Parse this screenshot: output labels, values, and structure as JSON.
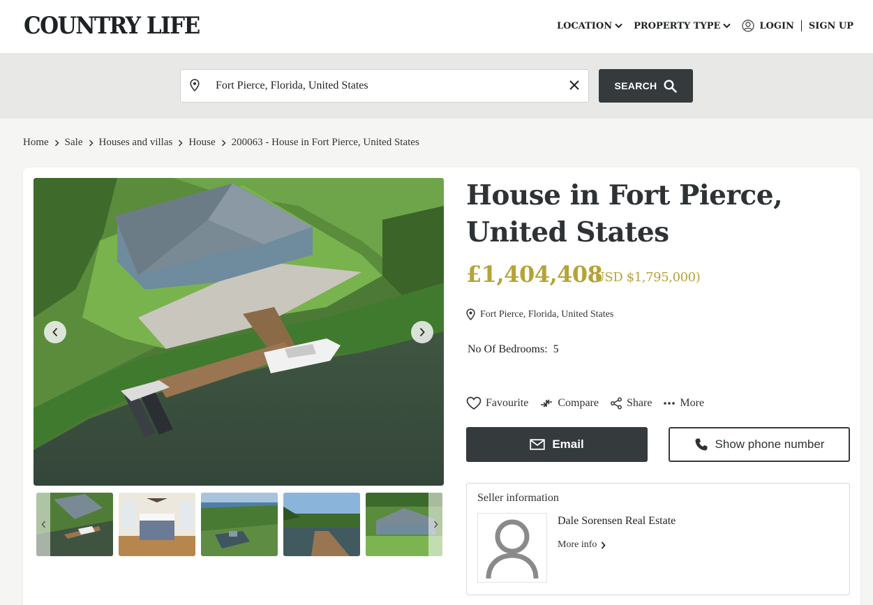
{
  "header": {
    "logo": "COUNTRY LIFE",
    "nav": {
      "location": "LOCATION",
      "property_type": "PROPERTY TYPE",
      "login": "LOGIN",
      "signup": "SIGN UP"
    }
  },
  "search": {
    "value": "Fort Pierce, Florida, United States",
    "button": "SEARCH"
  },
  "breadcrumb": [
    "Home",
    "Sale",
    "Houses and villas",
    "House",
    "200063 - House in Fort Pierce, United States"
  ],
  "listing": {
    "title": "House in Fort Pierce, United States",
    "price": "£1,404,408",
    "price_usd": "(USD $1,795,000)",
    "location": "Fort Pierce, Florida, United States",
    "bedrooms_label": "No Of Bedrooms:",
    "bedrooms_value": "5"
  },
  "actions": {
    "favourite": "Favourite",
    "compare": "Compare",
    "share": "Share",
    "more": "More"
  },
  "contact": {
    "email": "Email",
    "phone": "Show phone number"
  },
  "seller": {
    "title": "Seller information",
    "name": "Dale Sorensen Real Estate",
    "more": "More info"
  },
  "colors": {
    "accent_gold": "#b5a33a",
    "dark_button": "#353a3c"
  },
  "icons": [
    "map-pin-icon",
    "close-icon",
    "search-icon",
    "chevron-down-icon",
    "user-circle-icon",
    "chevron-left-icon",
    "chevron-right-icon",
    "heart-icon",
    "compare-icon",
    "share-icon",
    "more-dots-icon",
    "mail-icon",
    "phone-icon",
    "person-placeholder-icon"
  ]
}
